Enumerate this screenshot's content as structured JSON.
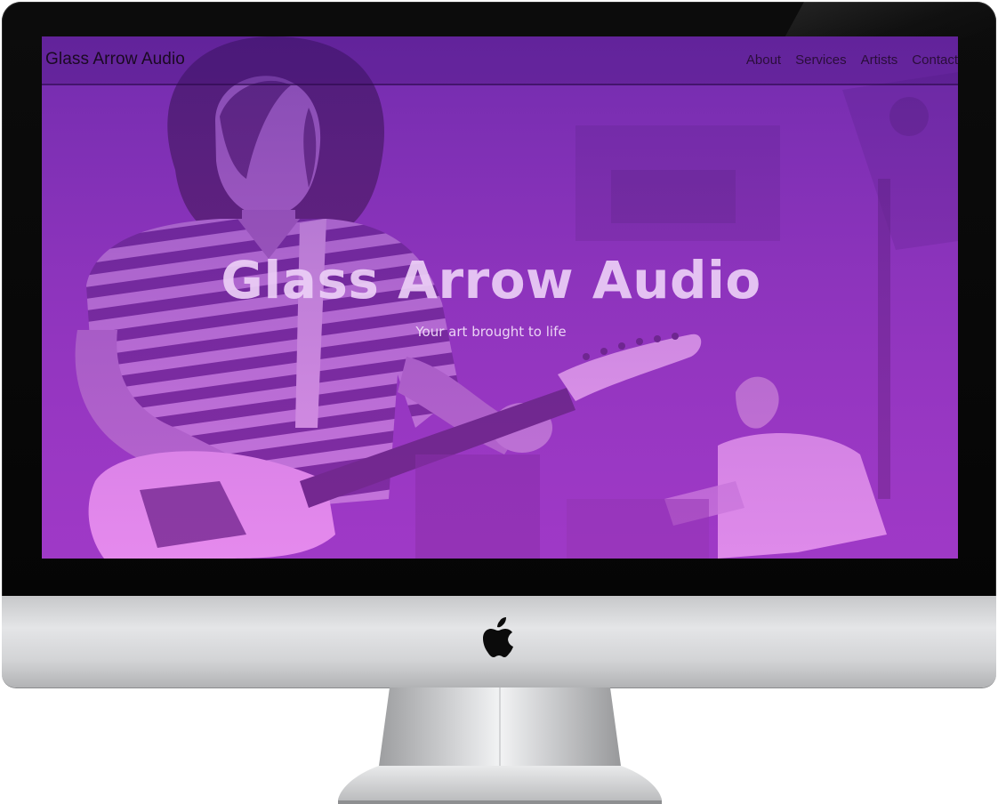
{
  "site": {
    "brand": "Glass Arrow Audio",
    "nav": [
      {
        "label": "About"
      },
      {
        "label": "Services"
      },
      {
        "label": "Artists"
      },
      {
        "label": "Contact"
      }
    ]
  },
  "hero": {
    "title": "Glass Arrow Audio",
    "subtitle": "Your art brought to life",
    "overlay_color_top": "#6a2aa6",
    "overlay_color_bottom": "#e24fe6"
  },
  "device": {
    "logo_icon": "apple-logo-icon"
  }
}
